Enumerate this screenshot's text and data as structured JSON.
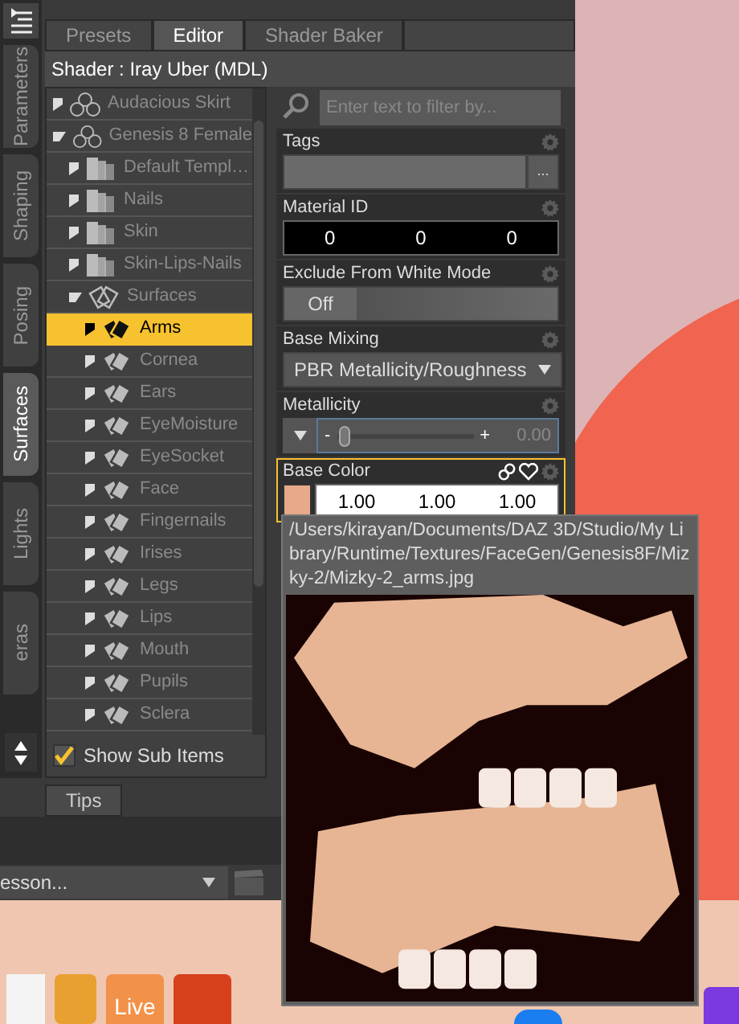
{
  "side_tabs": [
    {
      "label": "Parameters",
      "selected": false
    },
    {
      "label": "Shaping",
      "selected": false
    },
    {
      "label": "Posing",
      "selected": false
    },
    {
      "label": "Surfaces",
      "selected": true
    },
    {
      "label": "Lights",
      "selected": false
    },
    {
      "label": "eras",
      "selected": false
    }
  ],
  "tabs": [
    {
      "label": "Presets",
      "selected": false
    },
    {
      "label": "Editor",
      "selected": true
    },
    {
      "label": "Shader Baker",
      "selected": false
    }
  ],
  "shader_label": "Shader : Iray Uber (MDL)",
  "tree": [
    {
      "label": "Audacious Skirt",
      "kind": "figure",
      "expanded": false,
      "selected": false
    },
    {
      "label": "Genesis 8 Female",
      "kind": "figure",
      "expanded": true,
      "selected": false,
      "children": [
        {
          "label": "Default Templ…",
          "kind": "group",
          "expanded": false,
          "selected": false
        },
        {
          "label": "Nails",
          "kind": "group",
          "expanded": false,
          "selected": false
        },
        {
          "label": "Skin",
          "kind": "group",
          "expanded": false,
          "selected": false
        },
        {
          "label": "Skin-Lips-Nails",
          "kind": "group",
          "expanded": false,
          "selected": false
        },
        {
          "label": "Surfaces",
          "kind": "surfaces",
          "expanded": true,
          "selected": false,
          "children": [
            {
              "label": "Arms",
              "kind": "surface",
              "expanded": false,
              "selected": true
            },
            {
              "label": "Cornea",
              "kind": "surface",
              "expanded": false,
              "selected": false
            },
            {
              "label": "Ears",
              "kind": "surface",
              "expanded": false,
              "selected": false
            },
            {
              "label": "EyeMoisture",
              "kind": "surface",
              "expanded": false,
              "selected": false
            },
            {
              "label": "EyeSocket",
              "kind": "surface",
              "expanded": false,
              "selected": false
            },
            {
              "label": "Face",
              "kind": "surface",
              "expanded": false,
              "selected": false
            },
            {
              "label": "Fingernails",
              "kind": "surface",
              "expanded": false,
              "selected": false
            },
            {
              "label": "Irises",
              "kind": "surface",
              "expanded": false,
              "selected": false
            },
            {
              "label": "Legs",
              "kind": "surface",
              "expanded": false,
              "selected": false
            },
            {
              "label": "Lips",
              "kind": "surface",
              "expanded": false,
              "selected": false
            },
            {
              "label": "Mouth",
              "kind": "surface",
              "expanded": false,
              "selected": false
            },
            {
              "label": "Pupils",
              "kind": "surface",
              "expanded": false,
              "selected": false
            },
            {
              "label": "Sclera",
              "kind": "surface",
              "expanded": false,
              "selected": false
            }
          ]
        }
      ]
    }
  ],
  "show_sub_items": {
    "label": "Show Sub Items",
    "checked": true
  },
  "filter": {
    "placeholder": "Enter text to filter by..."
  },
  "properties": [
    {
      "kind": "tags",
      "label": "Tags",
      "button": "...",
      "selected": false
    },
    {
      "kind": "numbers",
      "label": "Material ID",
      "values": [
        "0",
        "0",
        "0"
      ],
      "selected": false
    },
    {
      "kind": "toggle",
      "label": "Exclude From White Mode",
      "value": "Off",
      "on": false,
      "selected": false
    },
    {
      "kind": "dropdown",
      "label": "Base Mixing",
      "value": "PBR Metallicity/Roughness",
      "selected": false
    },
    {
      "kind": "slider",
      "label": "Metallicity",
      "level": 0.05,
      "minus": "-",
      "plus": "+",
      "reading": "0.00",
      "selected": false
    },
    {
      "kind": "color",
      "label": "Base Color",
      "values": [
        "1.00",
        "1.00",
        "1.00"
      ],
      "selected": true
    }
  ],
  "tooltip": {
    "path": "/Users/kirayan/Documents/DAZ 3D/Studio/My Library/Runtime/Textures/FaceGen/Genesis8F/Mizky-2/Mizky-2_arms.jpg"
  },
  "bottom_tabs": [
    {
      "label": "Tips",
      "selected": true
    }
  ],
  "lesson_dropdown": {
    "value": "esson..."
  },
  "dock": {
    "live_label": "Live"
  }
}
